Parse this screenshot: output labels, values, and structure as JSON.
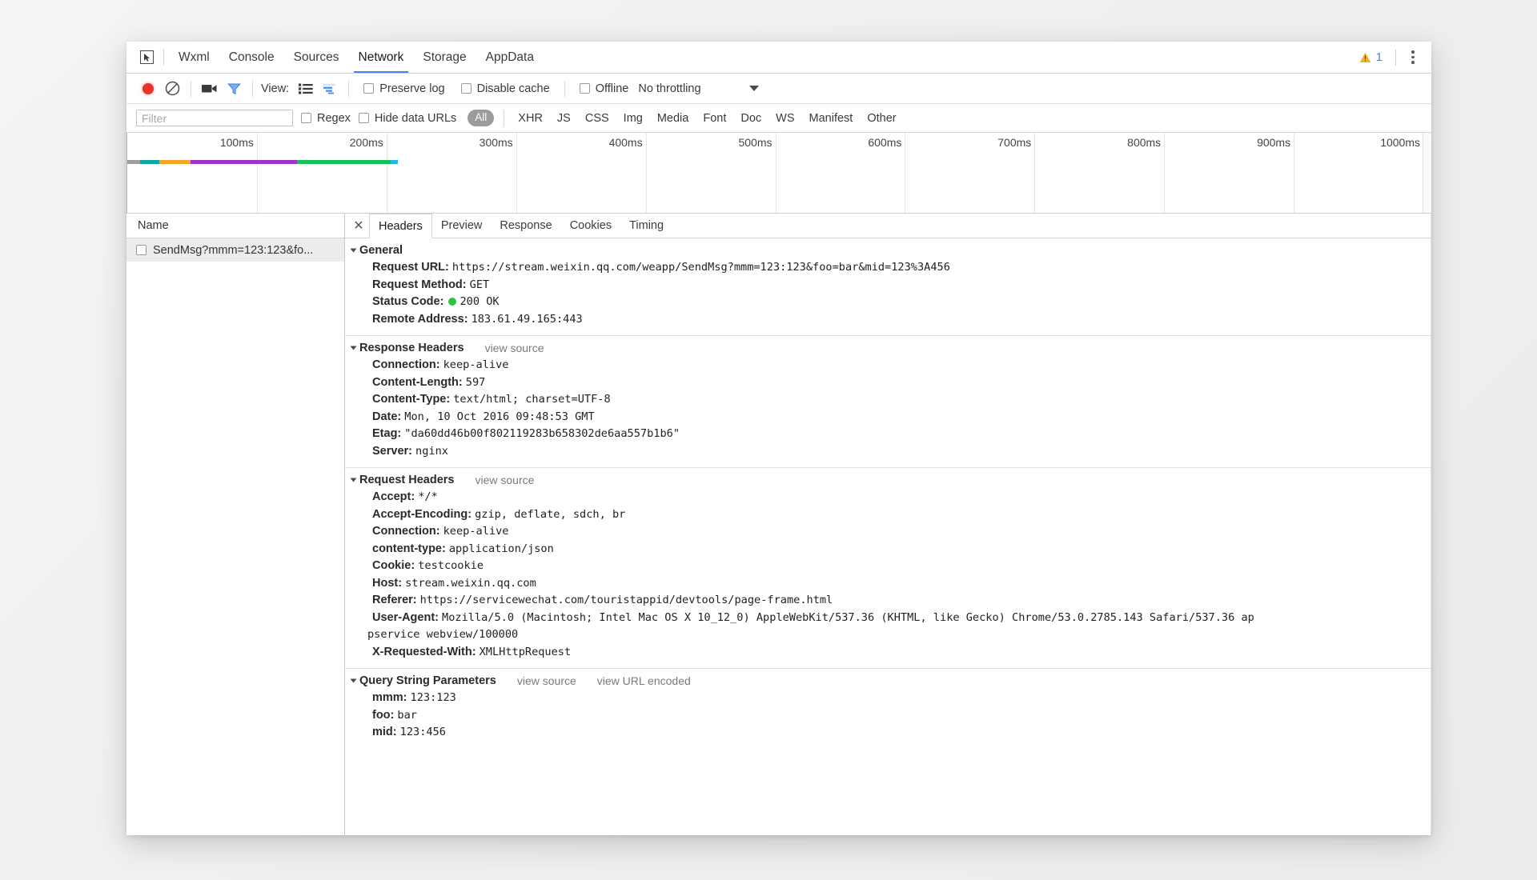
{
  "tabbar": {
    "inspect_icon": "cursor-select-icon",
    "tabs": [
      {
        "label": "Wxml",
        "active": false
      },
      {
        "label": "Console",
        "active": false
      },
      {
        "label": "Sources",
        "active": false
      },
      {
        "label": "Network",
        "active": true
      },
      {
        "label": "Storage",
        "active": false
      },
      {
        "label": "AppData",
        "active": false
      }
    ],
    "warning_count": "1",
    "warning_icon": "warning-triangle-icon",
    "menu_icon": "more-vertical-icon"
  },
  "toolbar": {
    "record_icon": "record-circle-icon",
    "clear_icon": "clear-prohibited-icon",
    "camera_icon": "video-camera-icon",
    "filter_icon": "funnel-filter-icon",
    "view_label": "View:",
    "view_list_icon": "list-view-icon",
    "view_waterfall_icon": "waterfall-view-icon",
    "preserve_log": "Preserve log",
    "disable_cache": "Disable cache",
    "offline": "Offline",
    "throttling": "No throttling",
    "caret_icon": "chevron-down-icon"
  },
  "filterbar": {
    "placeholder": "Filter",
    "value": "",
    "regex": "Regex",
    "hide_data_urls": "Hide data URLs",
    "types": [
      "All",
      "XHR",
      "JS",
      "CSS",
      "Img",
      "Media",
      "Font",
      "Doc",
      "WS",
      "Manifest",
      "Other"
    ],
    "active_type": "All"
  },
  "overview": {
    "ticks": [
      "100ms",
      "200ms",
      "300ms",
      "400ms",
      "500ms",
      "600ms",
      "700ms",
      "800ms",
      "900ms",
      "1000ms"
    ],
    "bar_segments": [
      {
        "color": "#9e9e9e",
        "width_pct": 1.0
      },
      {
        "color": "#16a3a3",
        "width_pct": 1.5
      },
      {
        "color": "#f5a623",
        "width_pct": 2.4
      },
      {
        "color": "#a234c4",
        "width_pct": 8.2
      },
      {
        "color": "#15c254",
        "width_pct": 7.2
      },
      {
        "color": "#23b8e8",
        "width_pct": 0.6
      }
    ]
  },
  "request_list": {
    "column_header": "Name",
    "rows": [
      {
        "name": "SendMsg?mmm=123:123&fo...",
        "selected": true
      }
    ]
  },
  "details": {
    "close_icon": "close-icon",
    "tabs": [
      {
        "label": "Headers",
        "active": true
      },
      {
        "label": "Preview",
        "active": false
      },
      {
        "label": "Response",
        "active": false
      },
      {
        "label": "Cookies",
        "active": false
      },
      {
        "label": "Timing",
        "active": false
      }
    ],
    "sections": [
      {
        "title": "General",
        "links": [],
        "rows": [
          {
            "key": "Request URL:",
            "value": "https://stream.weixin.qq.com/weapp/SendMsg?mmm=123:123&foo=bar&mid=123%3A456"
          },
          {
            "key": "Request Method:",
            "value": "GET"
          },
          {
            "key": "Status Code:",
            "value": "200 OK",
            "status_dot": true
          },
          {
            "key": "Remote Address:",
            "value": "183.61.49.165:443"
          }
        ]
      },
      {
        "title": "Response Headers",
        "links": [
          "view source"
        ],
        "rows": [
          {
            "key": "Connection:",
            "value": "keep-alive"
          },
          {
            "key": "Content-Length:",
            "value": "597"
          },
          {
            "key": "Content-Type:",
            "value": "text/html; charset=UTF-8"
          },
          {
            "key": "Date:",
            "value": "Mon, 10 Oct 2016 09:48:53 GMT"
          },
          {
            "key": "Etag:",
            "value": "\"da60dd46b00f802119283b658302de6aa557b1b6\""
          },
          {
            "key": "Server:",
            "value": "nginx"
          }
        ]
      },
      {
        "title": "Request Headers",
        "links": [
          "view source"
        ],
        "rows": [
          {
            "key": "Accept:",
            "value": "*/*"
          },
          {
            "key": "Accept-Encoding:",
            "value": "gzip, deflate, sdch, br"
          },
          {
            "key": "Connection:",
            "value": "keep-alive"
          },
          {
            "key": "content-type:",
            "value": "application/json"
          },
          {
            "key": "Cookie:",
            "value": "testcookie"
          },
          {
            "key": "Host:",
            "value": "stream.weixin.qq.com"
          },
          {
            "key": "Referer:",
            "value": "https://servicewechat.com/touristappid/devtools/page-frame.html"
          },
          {
            "key": "User-Agent:",
            "value": "Mozilla/5.0 (Macintosh; Intel Mac OS X 10_12_0) AppleWebKit/537.36 (KHTML, like Gecko) Chrome/53.0.2785.143 Safari/537.36 ap",
            "wrap_tail": "pservice webview/100000"
          },
          {
            "key": "X-Requested-With:",
            "value": "XMLHttpRequest"
          }
        ]
      },
      {
        "title": "Query String Parameters",
        "links": [
          "view source",
          "view URL encoded"
        ],
        "rows": [
          {
            "key": "mmm:",
            "value": "123:123"
          },
          {
            "key": "foo:",
            "value": "bar"
          },
          {
            "key": "mid:",
            "value": "123:456"
          }
        ]
      }
    ]
  }
}
